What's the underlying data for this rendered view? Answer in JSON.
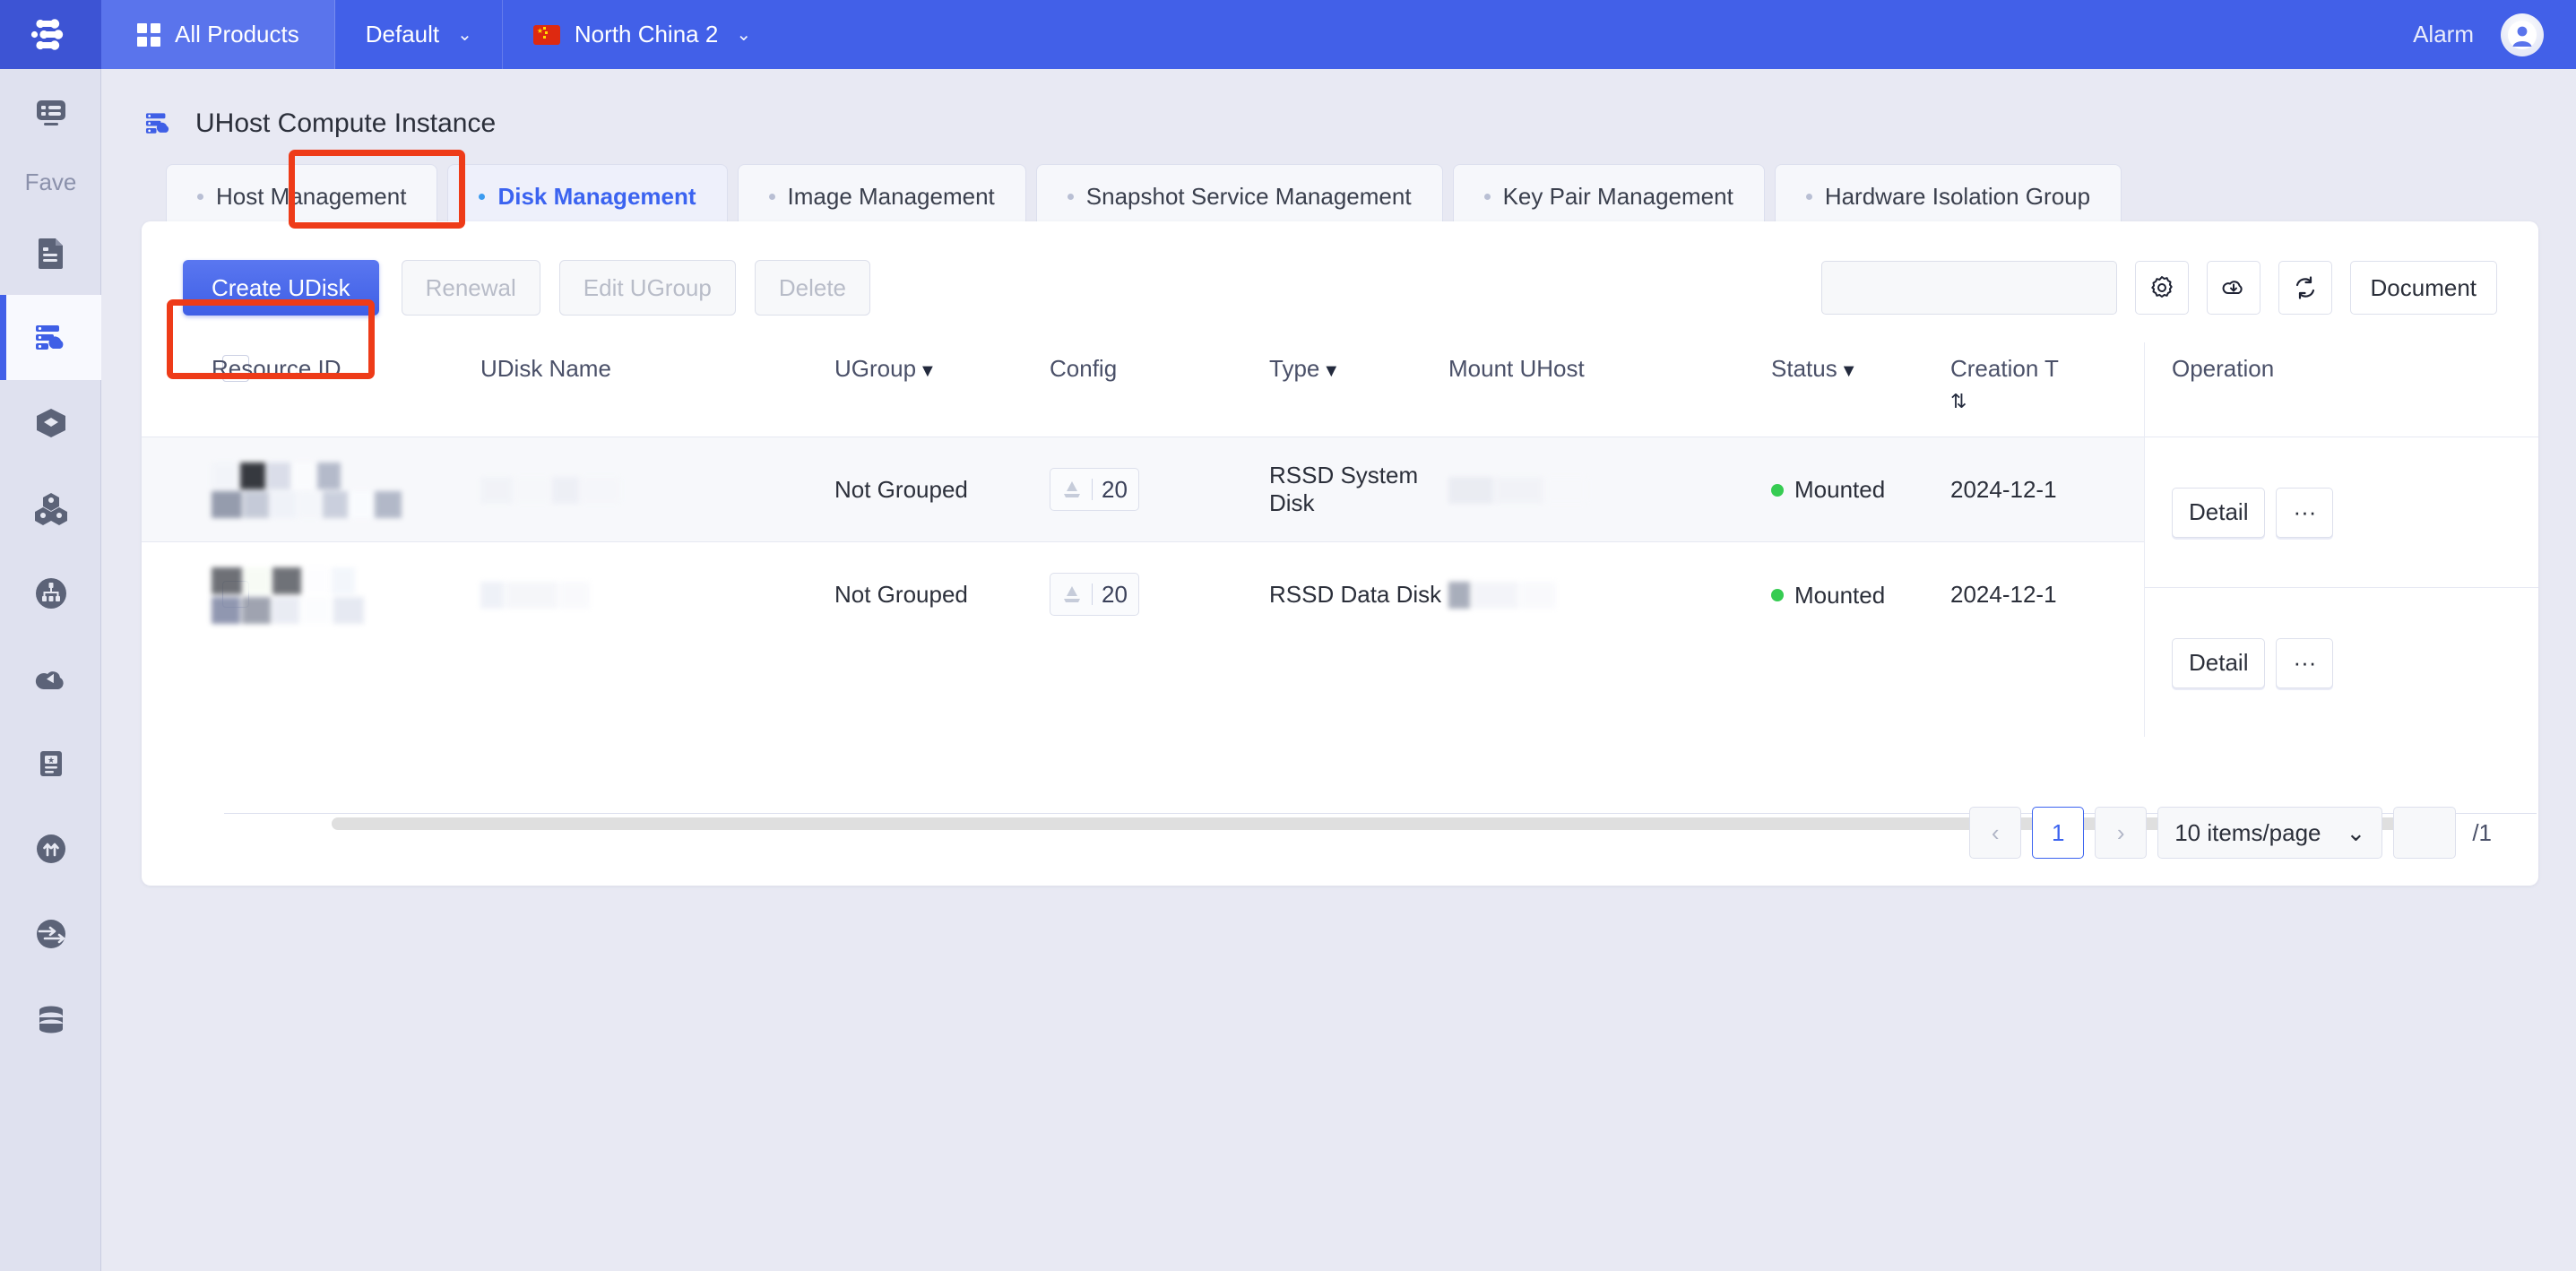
{
  "topbar": {
    "logo_icon": "ucloud-logo-icon",
    "all_products_label": "All Products",
    "project_label": "Default",
    "region_label": "North China 2",
    "alarm_label": "Alarm",
    "avatar_icon": "user-avatar-icon",
    "background_color": "#4260e8"
  },
  "sidebar": {
    "fave_label": "Fave",
    "items": [
      {
        "icon": "console-overview-icon",
        "active": false
      },
      {
        "icon": "document-icon",
        "active": false
      },
      {
        "icon": "uhost-server-cloud-icon",
        "active": true
      },
      {
        "icon": "cube-icon",
        "active": false
      },
      {
        "icon": "cluster-cubes-icon",
        "active": false
      },
      {
        "icon": "network-topology-icon",
        "active": false
      },
      {
        "icon": "cloud-drop-icon",
        "active": false
      },
      {
        "icon": "certificate-icon",
        "active": false
      },
      {
        "icon": "arrows-up-icon",
        "active": false
      },
      {
        "icon": "transfer-arrow-icon",
        "active": false
      },
      {
        "icon": "database-icon",
        "active": false
      }
    ]
  },
  "page": {
    "icon": "uhost-server-cloud-icon",
    "title": "UHost Compute Instance"
  },
  "tabs": [
    {
      "label": "Host Management",
      "active": false
    },
    {
      "label": "Disk Management",
      "active": true
    },
    {
      "label": "Image Management",
      "active": false
    },
    {
      "label": "Snapshot Service Management",
      "active": false
    },
    {
      "label": "Key Pair Management",
      "active": false
    },
    {
      "label": "Hardware Isolation Group",
      "active": false
    }
  ],
  "annotations": {
    "highlight_color": "#ee3b18",
    "boxes": [
      "disk-management-tab",
      "create-udisk-button"
    ]
  },
  "toolbar": {
    "create_label": "Create UDisk",
    "renewal_label": "Renewal",
    "edit_ugroup_label": "Edit UGroup",
    "delete_label": "Delete",
    "search_value": "",
    "search_placeholder": "",
    "search_icon": "search-icon",
    "settings_icon": "gear-icon",
    "download_icon": "cloud-download-icon",
    "refresh_icon": "refresh-icon",
    "document_label": "Document",
    "primary_color": "#4260e8"
  },
  "table": {
    "columns": [
      {
        "label": "Resource ID",
        "filter": false,
        "sort": false
      },
      {
        "label": "UDisk Name",
        "filter": false,
        "sort": false
      },
      {
        "label": "UGroup",
        "filter": true,
        "sort": false
      },
      {
        "label": "Config",
        "filter": false,
        "sort": false
      },
      {
        "label": "Type",
        "filter": true,
        "sort": false
      },
      {
        "label": "Mount UHost",
        "filter": false,
        "sort": false
      },
      {
        "label": "Status",
        "filter": true,
        "sort": false
      },
      {
        "label": "Creation T",
        "filter": false,
        "sort": true
      },
      {
        "label": "Operation",
        "filter": false,
        "sort": false
      }
    ],
    "rows": [
      {
        "resource_id": "redacted",
        "udisk_name": "redacted",
        "ugroup": "Not Grouped",
        "config_icon": "disk-size-icon",
        "config_value": "20",
        "type": "RSSD System Disk",
        "mount_uhost": "redacted",
        "status": "Mounted",
        "status_color": "#36cc52",
        "creation_time": "2024-12-1",
        "detail_label": "Detail",
        "more_label": "···"
      },
      {
        "resource_id": "redacted",
        "udisk_name": "redacted",
        "ugroup": "Not Grouped",
        "config_icon": "disk-size-icon",
        "config_value": "20",
        "type": "RSSD Data Disk",
        "mount_uhost": "redacted",
        "status": "Mounted",
        "status_color": "#36cc52",
        "creation_time": "2024-12-1",
        "detail_label": "Detail",
        "more_label": "···"
      }
    ]
  },
  "pagination": {
    "prev_icon": "chevron-left-icon",
    "next_icon": "chevron-right-icon",
    "current_page": "1",
    "page_size_label": "10 items/page",
    "jump_value": "",
    "total_pages_label": "/1"
  }
}
